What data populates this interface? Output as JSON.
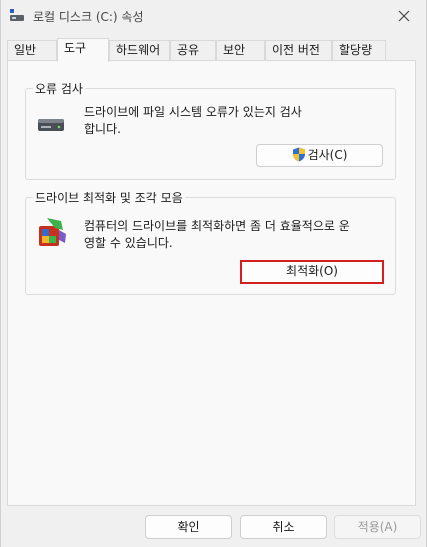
{
  "window": {
    "title": "로컬 디스크 (C:) 속성"
  },
  "tabs": [
    {
      "label": "일반",
      "active": false
    },
    {
      "label": "도구",
      "active": true
    },
    {
      "label": "하드웨어",
      "active": false
    },
    {
      "label": "공유",
      "active": false
    },
    {
      "label": "보안",
      "active": false
    },
    {
      "label": "이전 버전",
      "active": false
    },
    {
      "label": "할당량",
      "active": false
    }
  ],
  "error_check": {
    "title": "오류 검사",
    "description_line1": "드라이브에 파일 시스템 오류가 있는지 검사",
    "description_line2": "합니다.",
    "button_label": "검사(C)"
  },
  "optimize": {
    "title": "드라이브 최적화 및 조각 모음",
    "description_line1": "컴퓨터의 드라이브를 최적화하면 좀 더 효율적으로 운",
    "description_line2": "영할 수 있습니다.",
    "button_label": "최적화(O)"
  },
  "footer": {
    "ok_label": "확인",
    "cancel_label": "취소",
    "apply_label": "적용(A)"
  },
  "colors": {
    "focus_border": "#d21f1f",
    "background": "#f0f0f0",
    "panel": "#f9f9f9"
  }
}
